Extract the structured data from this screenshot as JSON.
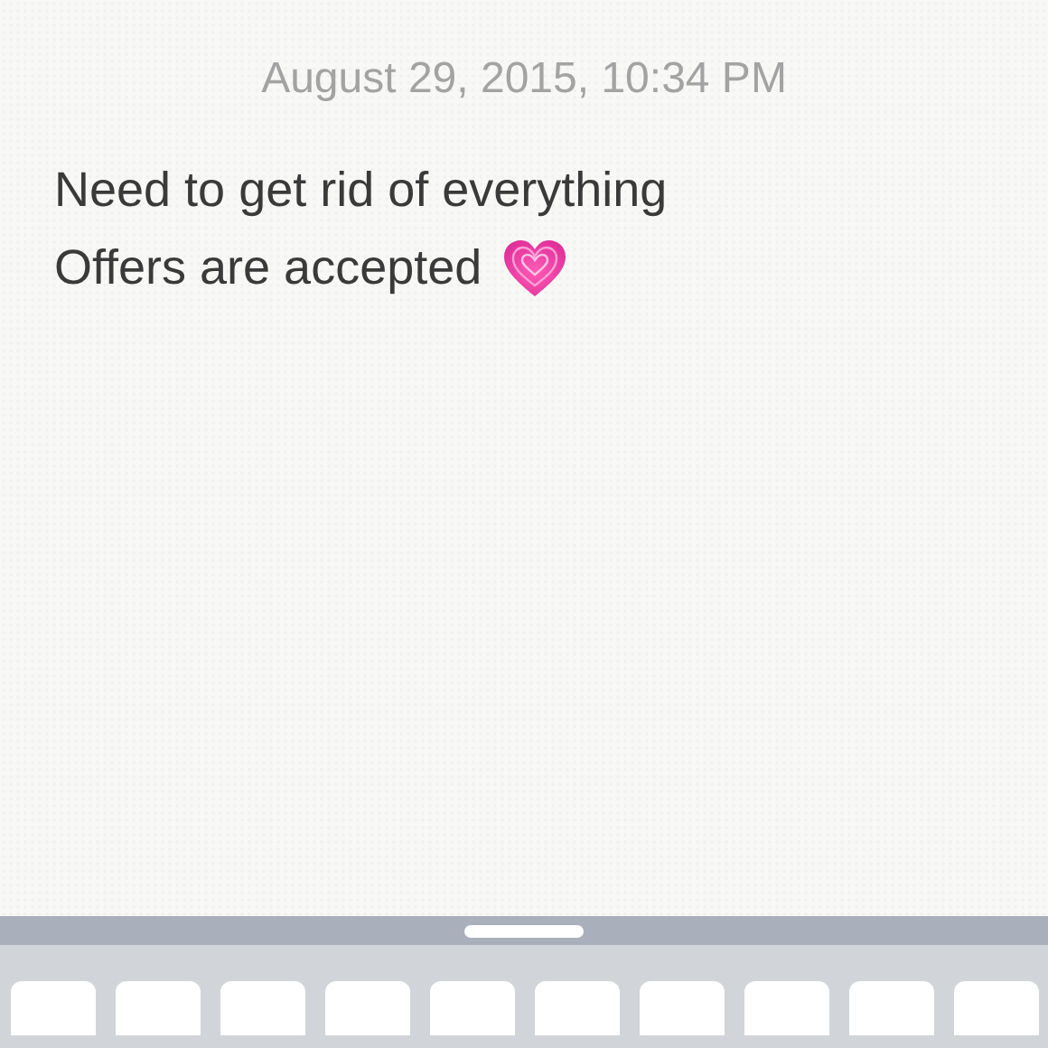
{
  "note": {
    "date": "August 29, 2015, 10:34 PM",
    "lines": [
      {
        "text": "Need to get rid of everything",
        "emoji": false
      },
      {
        "text": "Offers are accepted",
        "emoji": true
      }
    ]
  }
}
